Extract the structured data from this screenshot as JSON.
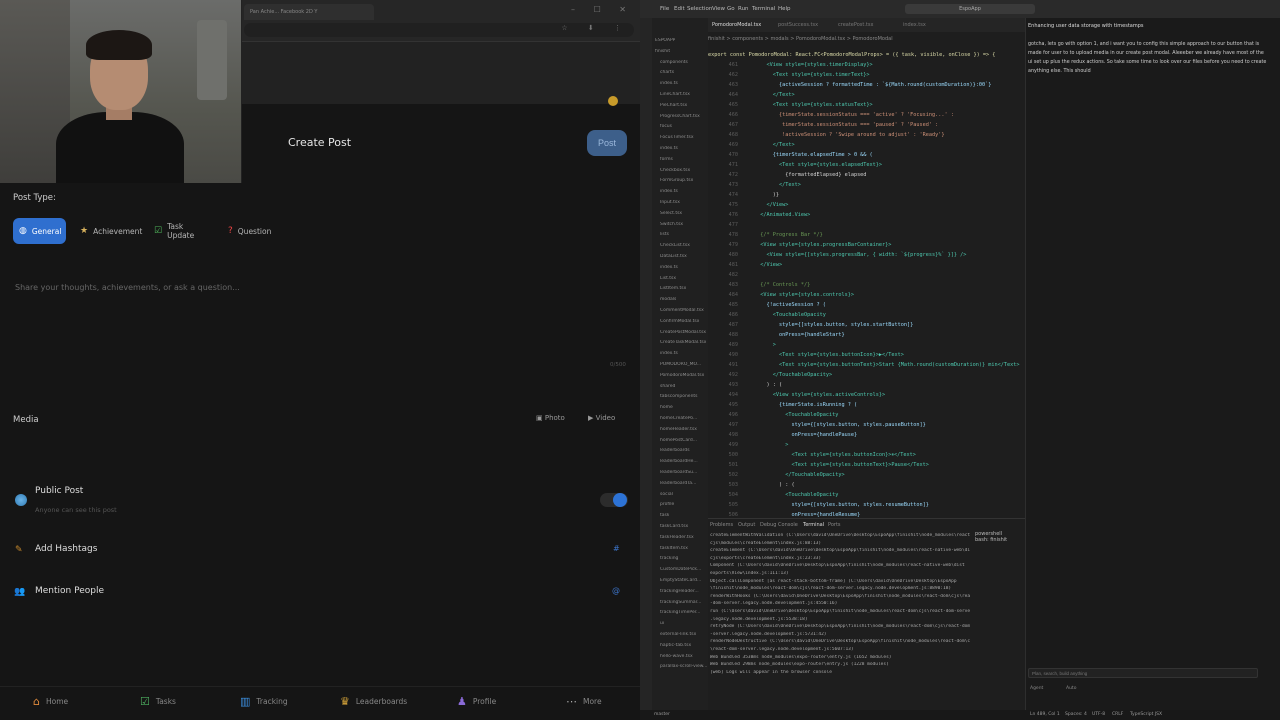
{
  "browser": {
    "tab_title": "Pan Achie... Facebook 2D Y",
    "window_controls": "– ☐ ✕"
  },
  "app": {
    "title": "Create Post",
    "post_button": "Post",
    "post_type_label": "Post Type:",
    "post_types": [
      {
        "label": "General",
        "icon": "globe-icon",
        "selected": true
      },
      {
        "label": "Achievement",
        "icon": "star-icon",
        "selected": false
      },
      {
        "label": "Task Update",
        "icon": "checkbox-icon",
        "selected": false
      },
      {
        "label": "Question",
        "icon": "question-icon",
        "selected": false
      }
    ],
    "placeholder": "Share your thoughts, achievements, or ask a question...",
    "char_count": "0/500",
    "media_label": "Media",
    "photo_label": "Photo",
    "video_label": "Video",
    "public_title": "Public Post",
    "public_sub": "Anyone can see this post",
    "public_enabled": true,
    "hashtags_label": "Add Hashtags",
    "hashtags_btn": "#",
    "mention_label": "Mention People",
    "mention_btn": "@",
    "nav": [
      {
        "label": "Home",
        "icon": "home-icon"
      },
      {
        "label": "Tasks",
        "icon": "tasks-icon"
      },
      {
        "label": "Tracking",
        "icon": "chart-icon"
      },
      {
        "label": "Leaderboards",
        "icon": "trophy-icon"
      },
      {
        "label": "Profile",
        "icon": "profile-icon"
      },
      {
        "label": "More",
        "icon": "more-icon"
      }
    ]
  },
  "vscode": {
    "menu": [
      "File",
      "Edit",
      "Selection",
      "View",
      "Go",
      "Run",
      "Terminal",
      "Help"
    ],
    "search": "EspoApp",
    "tabs": [
      "PomodoroModal.tsx",
      "postSuccess.tsx",
      "createPost.tsx",
      "index.tsx"
    ],
    "breadcrumbs": "finishit > components > modals > PomodoroModal.tsx > PomodoroModal",
    "signature": "export const PomodoroModal: React.FC<PomodoroModalProps> = ({ task, visible, onClose }) => {",
    "explorer": [
      "ESPOAPP",
      "finishit",
      "components",
      "charts",
      "index.ts",
      "LineChart.tsx",
      "PieChart.tsx",
      "ProgressChart.tsx",
      "focus",
      "FocusTimer.tsx",
      "index.ts",
      "forms",
      "Checkbox.tsx",
      "FormGroup.tsx",
      "index.ts",
      "Input.tsx",
      "Select.tsx",
      "Switch.tsx",
      "lists",
      "CheckList.tsx",
      "DataList.tsx",
      "index.ts",
      "List.tsx",
      "ListItem.tsx",
      "modals",
      "CommentModal.tsx",
      "ConfirmModal.tsx",
      "CreatePostModal.tsx",
      "CreateTaskModal.tsx",
      "index.ts",
      "POMODORO_MO...",
      "PomodoroModal.tsx",
      "shared",
      "tabscomponents",
      "home",
      "homeCreatePo...",
      "homeHeader.tsx",
      "homePostCard...",
      "leaderboards",
      "leaderboardHe...",
      "leaderboardSu...",
      "leaderboardTa...",
      "social",
      "profile",
      "task",
      "taskCard.tsx",
      "taskHeader.tsx",
      "taskItem.tsx",
      "tracking",
      "CustomDatePick...",
      "EmptyStateCard...",
      "trackingHeader...",
      "trackingSummar...",
      "trackingTimePer...",
      "ui",
      "external-link.tsx",
      "haptic-tab.tsx",
      "hello-wave.tsx",
      "parallax-scroll-view..."
    ],
    "code_lines": [
      {
        "n": "461",
        "text": "    <View style={styles.timerDisplay}>",
        "cls": "c-tag"
      },
      {
        "n": "462",
        "text": "      <Text style={styles.timerText}>",
        "cls": "c-tag"
      },
      {
        "n": "463",
        "text": "        {activeSession ? formattedTime : `${Math.round(customDuration)}:00`}",
        "cls": "c-attr"
      },
      {
        "n": "464",
        "text": "      </Text>",
        "cls": "c-tag"
      },
      {
        "n": "465",
        "text": "      <Text style={styles.statusText}>",
        "cls": "c-tag"
      },
      {
        "n": "466",
        "text": "        {timerState.sessionStatus === 'active' ? 'Focusing...' :",
        "cls": "c-str"
      },
      {
        "n": "467",
        "text": "         timerState.sessionStatus === 'paused' ? 'Paused' :",
        "cls": "c-str"
      },
      {
        "n": "468",
        "text": "         !activeSession ? 'Swipe around to adjust' : 'Ready'}",
        "cls": "c-str"
      },
      {
        "n": "469",
        "text": "      </Text>",
        "cls": "c-tag"
      },
      {
        "n": "470",
        "text": "      {timerState.elapsedTime > 0 && (",
        "cls": "c-attr"
      },
      {
        "n": "471",
        "text": "        <Text style={styles.elapsedText}>",
        "cls": "c-tag"
      },
      {
        "n": "472",
        "text": "          {formattedElapsed} elapsed",
        "cls": "c-txt"
      },
      {
        "n": "473",
        "text": "        </Text>",
        "cls": "c-tag"
      },
      {
        "n": "474",
        "text": "      )}",
        "cls": "c-txt"
      },
      {
        "n": "475",
        "text": "    </View>",
        "cls": "c-tag"
      },
      {
        "n": "476",
        "text": "  </Animated.View>",
        "cls": "c-tag"
      },
      {
        "n": "477",
        "text": "",
        "cls": "c-txt"
      },
      {
        "n": "478",
        "text": "  {/* Progress Bar */}",
        "cls": "c-com"
      },
      {
        "n": "479",
        "text": "  <View style={styles.progressBarContainer}>",
        "cls": "c-tag"
      },
      {
        "n": "480",
        "text": "    <View style={[styles.progressBar, { width: `${progress}%` }]} />",
        "cls": "c-tag"
      },
      {
        "n": "481",
        "text": "  </View>",
        "cls": "c-tag"
      },
      {
        "n": "482",
        "text": "",
        "cls": "c-txt"
      },
      {
        "n": "483",
        "text": "  {/* Controls */}",
        "cls": "c-com"
      },
      {
        "n": "484",
        "text": "  <View style={styles.controls}>",
        "cls": "c-tag"
      },
      {
        "n": "485",
        "text": "    {!activeSession ? (",
        "cls": "c-attr"
      },
      {
        "n": "486",
        "text": "      <TouchableOpacity",
        "cls": "c-tag"
      },
      {
        "n": "487",
        "text": "        style={[styles.button, styles.startButton]}",
        "cls": "c-attr"
      },
      {
        "n": "488",
        "text": "        onPress={handleStart}",
        "cls": "c-attr"
      },
      {
        "n": "489",
        "text": "      >",
        "cls": "c-tag"
      },
      {
        "n": "490",
        "text": "        <Text style={styles.buttonIcon}>▶</Text>",
        "cls": "c-tag"
      },
      {
        "n": "491",
        "text": "        <Text style={styles.buttonText}>Start {Math.round(customDuration)} min</Text>",
        "cls": "c-tag"
      },
      {
        "n": "492",
        "text": "      </TouchableOpacity>",
        "cls": "c-tag"
      },
      {
        "n": "493",
        "text": "    ) : (",
        "cls": "c-txt"
      },
      {
        "n": "494",
        "text": "      <View style={styles.activeControls}>",
        "cls": "c-tag"
      },
      {
        "n": "495",
        "text": "        {timerState.isRunning ? (",
        "cls": "c-attr"
      },
      {
        "n": "496",
        "text": "          <TouchableOpacity",
        "cls": "c-tag"
      },
      {
        "n": "497",
        "text": "            style={[styles.button, styles.pauseButton]}",
        "cls": "c-attr"
      },
      {
        "n": "498",
        "text": "            onPress={handlePause}",
        "cls": "c-attr"
      },
      {
        "n": "499",
        "text": "          >",
        "cls": "c-tag"
      },
      {
        "n": "500",
        "text": "            <Text style={styles.buttonIcon}>⏸</Text>",
        "cls": "c-tag"
      },
      {
        "n": "501",
        "text": "            <Text style={styles.buttonText}>Pause</Text>",
        "cls": "c-tag"
      },
      {
        "n": "502",
        "text": "          </TouchableOpacity>",
        "cls": "c-tag"
      },
      {
        "n": "503",
        "text": "        ) : (",
        "cls": "c-txt"
      },
      {
        "n": "504",
        "text": "          <TouchableOpacity",
        "cls": "c-tag"
      },
      {
        "n": "505",
        "text": "            style={[styles.button, styles.resumeButton]}",
        "cls": "c-attr"
      },
      {
        "n": "506",
        "text": "            onPress={handleResume}",
        "cls": "c-attr"
      }
    ],
    "terminal_tabs": [
      "Problems",
      "Output",
      "Debug Console",
      "Terminal",
      "Ports"
    ],
    "terminal_lines": [
      "createElementWithValidation (C:\\Users\\david\\OneDrive\\Desktop\\EspoApp\\finishit\\node_modules\\react-native-web\\dist",
      "cjs\\modules\\createElement\\index.js:88:13)",
      "  createElement (C:\\Users\\david\\OneDrive\\Desktop\\EspoApp\\finishit\\node_modules\\react-native-web\\dist",
      "cjs\\exports\\createElement\\index.js:23:33)",
      "  Component (C:\\Users\\david\\OneDrive\\Desktop\\EspoApp\\finishit\\node_modules\\react-native-web\\dist",
      "exports\\View\\index.js:111:13)",
      "  Object.callComponent [as react-stack-bottom-frame] (C:\\Users\\david\\OneDrive\\Desktop\\EspoApp",
      "\\finishit\\node_modules\\react-dom\\cjs\\react-dom-server.legacy.node.development.js:8890:18)",
      "  renderWithHooks (C:\\Users\\david\\OneDrive\\Desktop\\EspoApp\\finishit\\node_modules\\react-dom\\cjs\\react",
      "-dom-server.legacy.node.development.js:4550:16)",
      "  run (C:\\Users\\david\\OneDrive\\Desktop\\EspoApp\\finishit\\node_modules\\react-dom\\cjs\\react-dom-server",
      ".legacy.node.development.js:5538:18)",
      "  retryNode (C:\\Users\\david\\OneDrive\\Desktop\\EspoApp\\finishit\\node_modules\\react-dom\\cjs\\react-dom",
      "-server.legacy.node.development.js:5731:42)",
      "  renderNodeDestructive (C:\\Users\\david\\OneDrive\\Desktop\\EspoApp\\finishit\\node_modules\\react-dom\\cjs",
      "\\react-dom-server.legacy.node.development.js:5607:13)",
      "Web Bundled 3538ms node_modules\\expo-router\\entry.js (1652 modules)",
      "Web Bundled 298ms node_modules\\expo-router\\entry.js (1228 modules)",
      "[web] Logs will appear in the browser console"
    ],
    "terminal_side": [
      "powershell",
      "bash: finishit"
    ],
    "status": [
      "master",
      "Ln 489, Col 1",
      "Spaces: 4",
      "UTF-8",
      "CRLF",
      "TypeScript JSX"
    ],
    "chat_title": "Enhancing user data storage with timestamps",
    "chat_message": "gotcha, lets go with option 1, and i want you to config this simple approach to our button that is made for user to to upload media in our create post modal. Aleeeber we already have most of the ui set up plus the redux actions. So take some time to look over our files before you need to create anything else. This should",
    "chat_input_placeholder": "Plan, search, build anything",
    "chat_agent": "Agent",
    "chat_mode": "Auto"
  }
}
